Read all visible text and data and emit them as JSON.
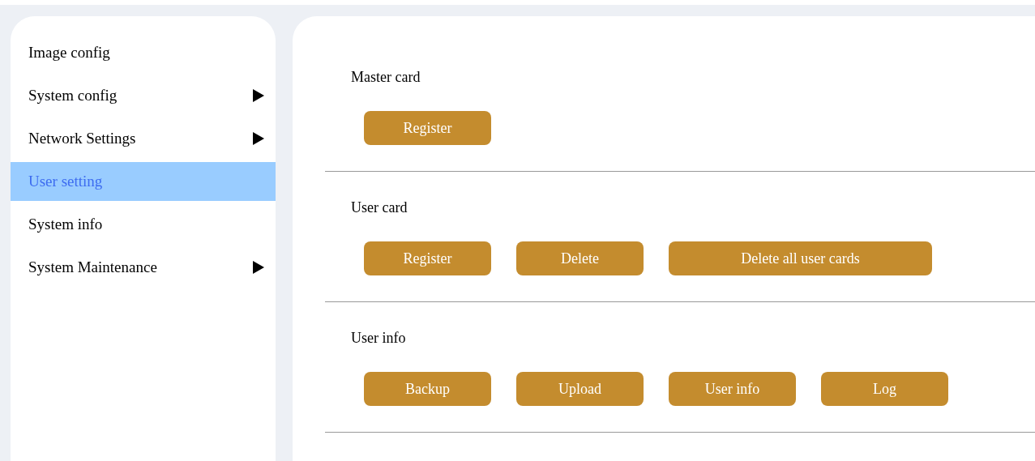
{
  "sidebar": {
    "items": [
      {
        "label": "Image config",
        "selected": false,
        "has_submenu": false
      },
      {
        "label": "System config",
        "selected": false,
        "has_submenu": true
      },
      {
        "label": "Network Settings",
        "selected": false,
        "has_submenu": true
      },
      {
        "label": "User setting",
        "selected": true,
        "has_submenu": false
      },
      {
        "label": "System info",
        "selected": false,
        "has_submenu": false
      },
      {
        "label": "System Maintenance",
        "selected": false,
        "has_submenu": true
      }
    ]
  },
  "sections": [
    {
      "title": "Master card",
      "buttons": [
        {
          "label": "Register",
          "wide": false
        }
      ]
    },
    {
      "title": "User card",
      "buttons": [
        {
          "label": "Register",
          "wide": false
        },
        {
          "label": "Delete",
          "wide": false
        },
        {
          "label": "Delete all user cards",
          "wide": true
        }
      ]
    },
    {
      "title": "User info",
      "buttons": [
        {
          "label": "Backup",
          "wide": false
        },
        {
          "label": "Upload",
          "wide": false
        },
        {
          "label": "User info",
          "wide": false
        },
        {
          "label": "Log",
          "wide": false
        }
      ]
    }
  ]
}
